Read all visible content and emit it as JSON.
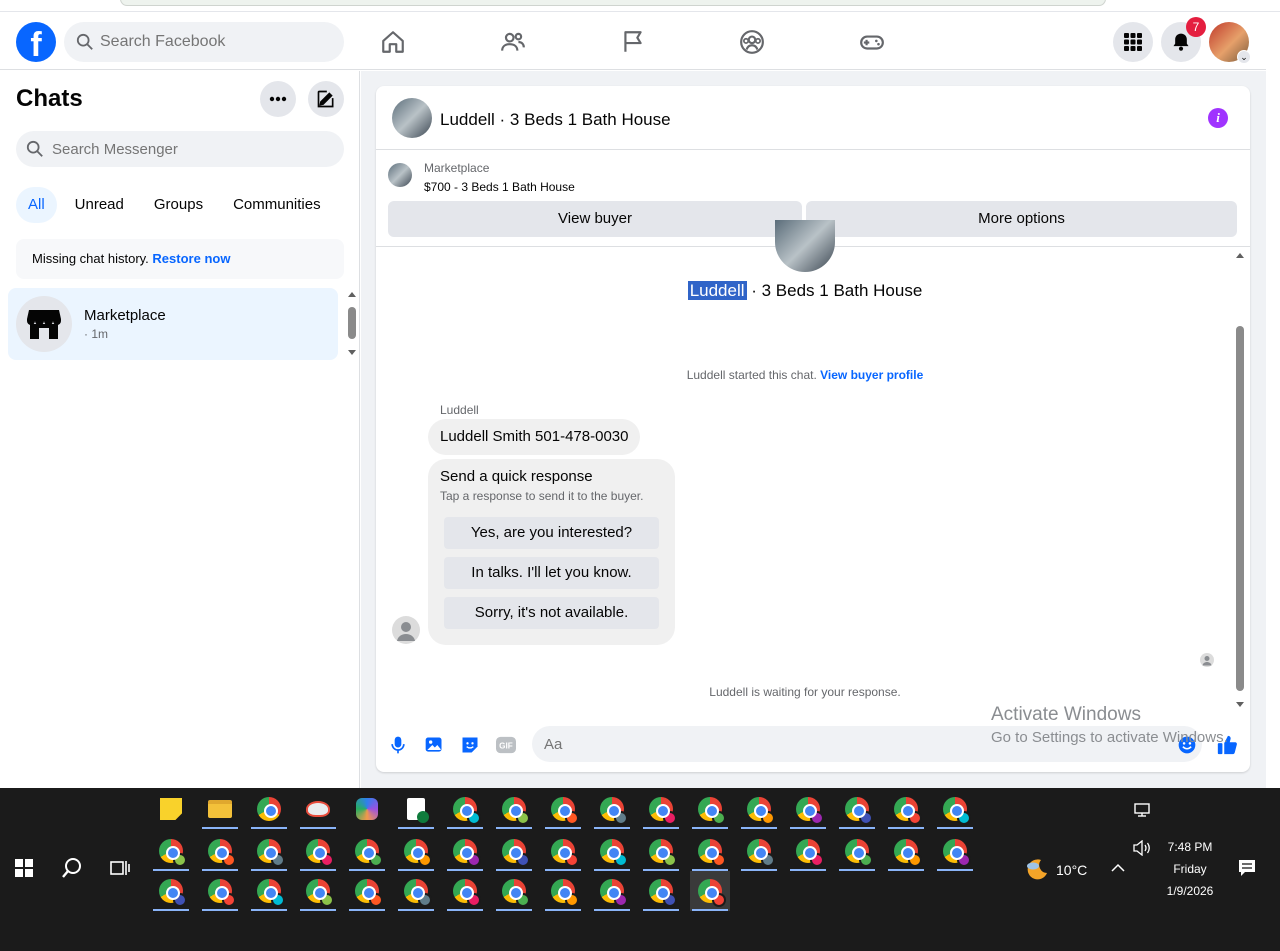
{
  "topbar": {
    "search_placeholder": "Search Facebook",
    "notification_count": "7"
  },
  "sidebar": {
    "title": "Chats",
    "search_placeholder": "Search Messenger",
    "filters": [
      "All",
      "Unread",
      "Groups",
      "Communities"
    ],
    "missing_text": "Missing chat history.",
    "restore_link": "Restore now",
    "chat": {
      "name": "Marketplace",
      "time": "· 1m"
    }
  },
  "conversation": {
    "header_title": "Luddell · 3 Beds 1 Bath House",
    "listing_label": "Marketplace",
    "listing_price": "$700 - 3 Beds 1 Bath House",
    "view_buyer": "View buyer",
    "more_options": "More options",
    "title_highlight": "Luddell",
    "title_rest": " · 3 Beds 1 Bath House",
    "started_text": "Luddell started this chat.",
    "view_profile": "View buyer profile",
    "sender": "Luddell",
    "message": "Luddell Smith 501-478-0030",
    "quick_title": "Send a quick response",
    "quick_sub": "Tap a response to send it to the buyer.",
    "quick_responses": [
      "Yes, are you interested?",
      "In talks. I'll let you know.",
      "Sorry, it's not available."
    ],
    "waiting": "Luddell is waiting for your response.",
    "composer_placeholder": "Aa"
  },
  "watermark": {
    "line1": "Activate Windows",
    "line2": "Go to Settings to activate Windows."
  },
  "taskbar": {
    "temperature": "10°C",
    "time": "7:48 PM",
    "day": "Friday",
    "date": "1/9/2026"
  },
  "colors": {
    "brand": "#0866ff",
    "badge": "#e41e3f",
    "info": "#a033ff",
    "taskbar": "#1b1b1b"
  }
}
